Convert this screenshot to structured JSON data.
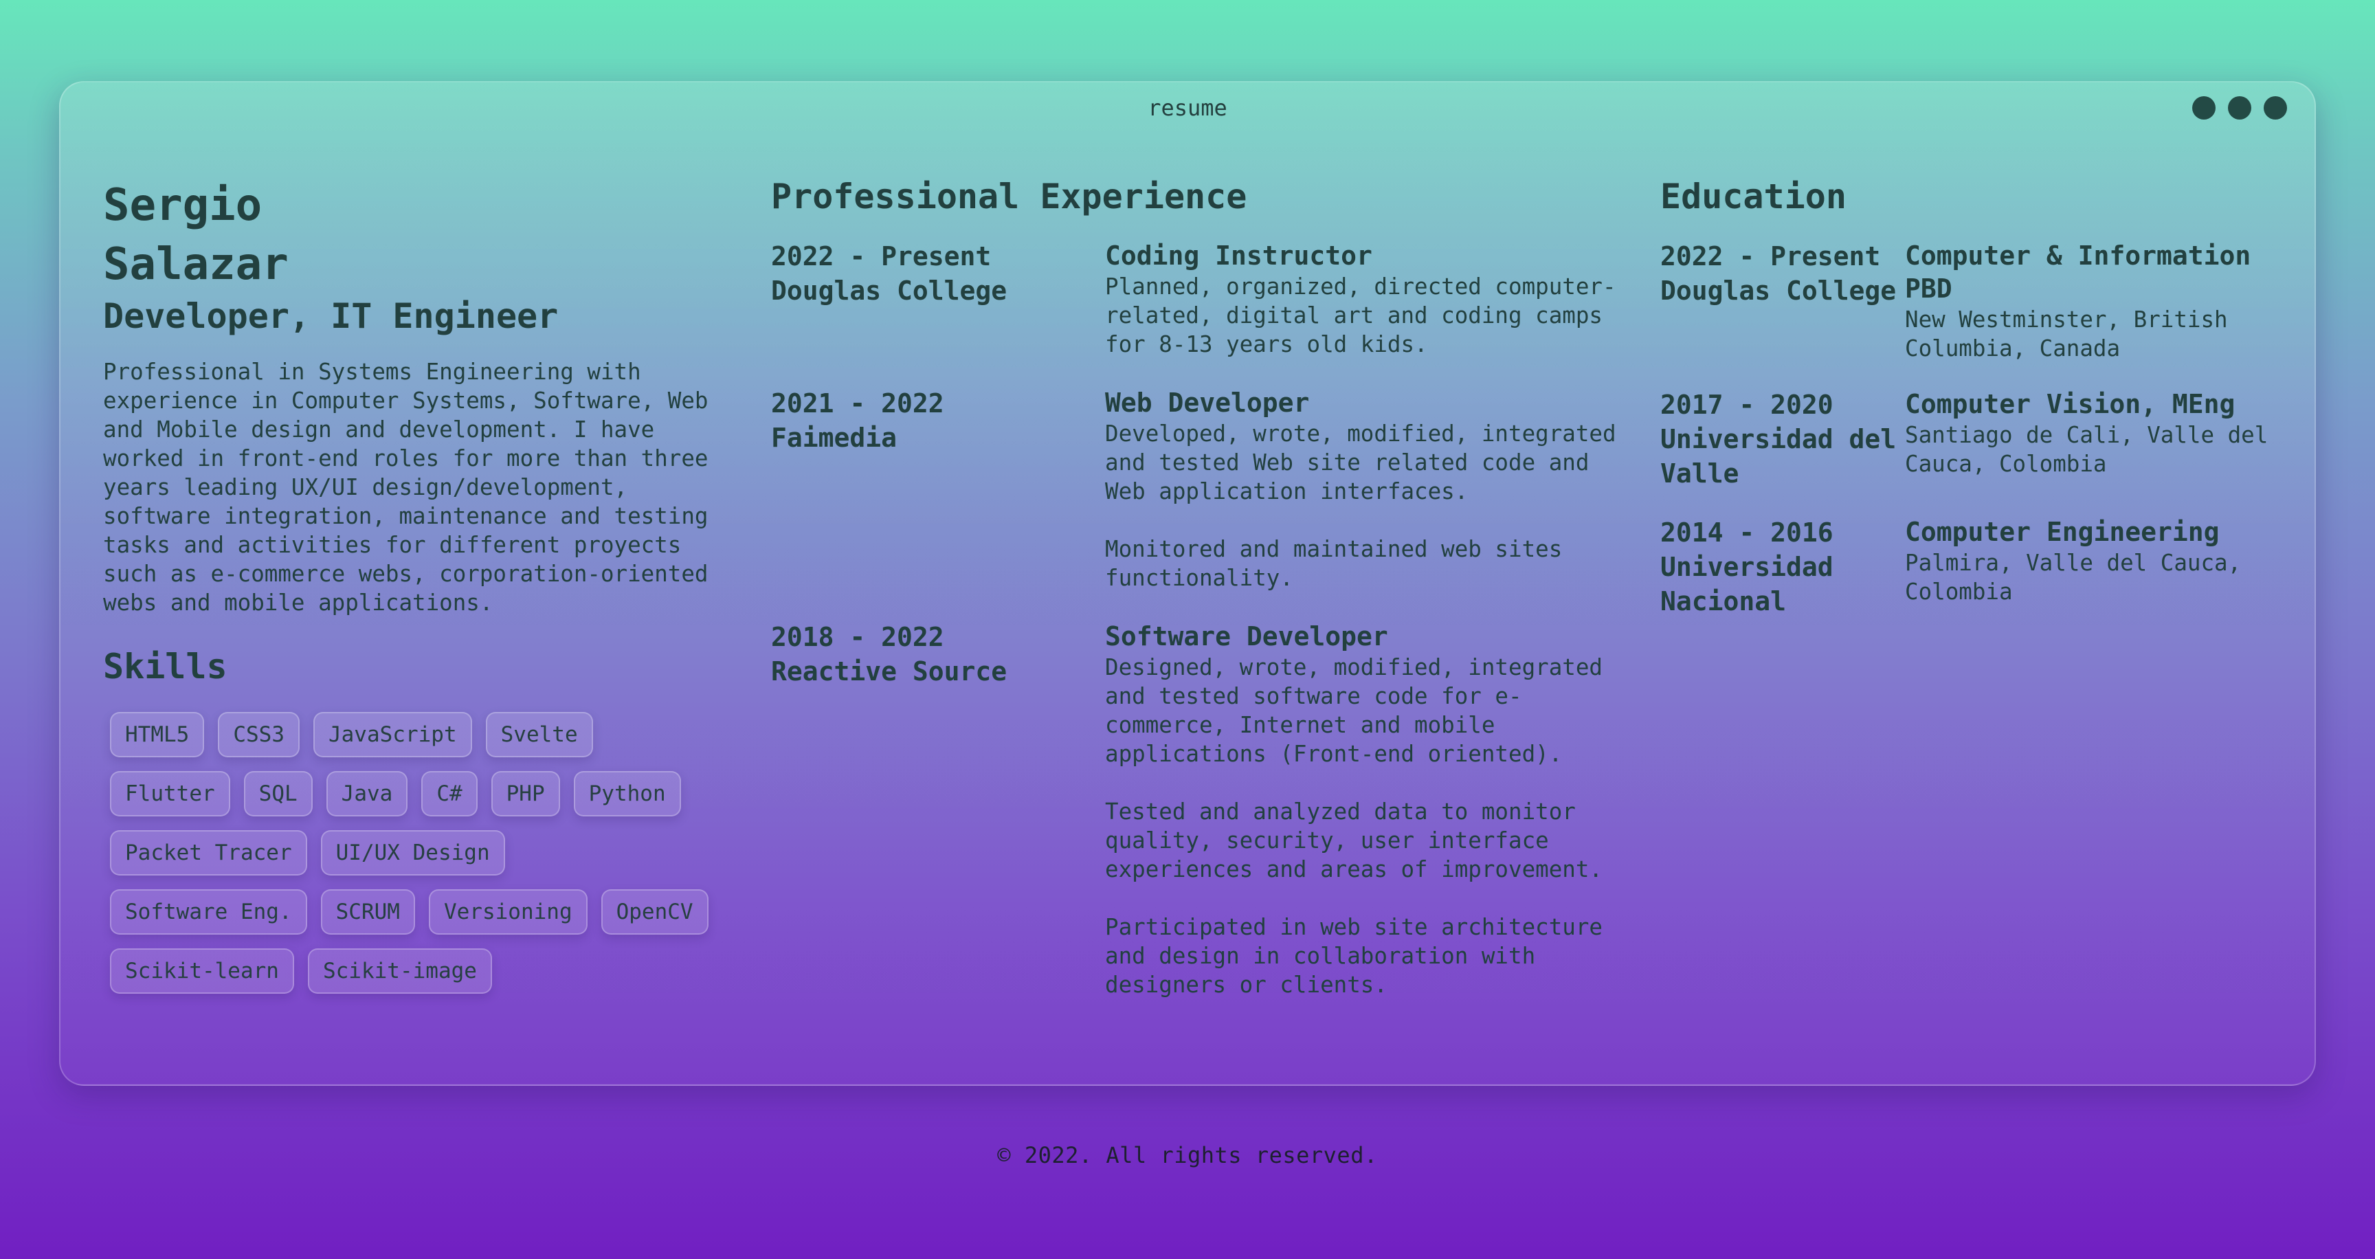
{
  "window": {
    "title": "resume"
  },
  "profile": {
    "first_name": "Sergio",
    "last_name": "Salazar",
    "role": "Developer, IT Engineer",
    "summary": "Professional in Systems Engineering with experience in Computer Systems, Software, Web and Mobile design and development. I have worked in front-end roles for more than three years leading UX/UI design/development, software integration, maintenance and testing tasks and activities for different proyects such as e-commerce webs, corporation-oriented webs and mobile applications."
  },
  "skills": {
    "title": "Skills",
    "items": [
      "HTML5",
      "CSS3",
      "JavaScript",
      "Svelte",
      "Flutter",
      "SQL",
      "Java",
      "C#",
      "PHP",
      "Python",
      "Packet Tracer",
      "UI/UX Design",
      "Software Eng.",
      "SCRUM",
      "Versioning",
      "OpenCV",
      "Scikit-learn",
      "Scikit-image"
    ]
  },
  "experience": {
    "title": "Professional Experience",
    "items": [
      {
        "period": "2022 - Present",
        "company": "Douglas College",
        "position": "Coding Instructor",
        "paragraphs": [
          "Planned, organized, directed computer-related, digital art and coding camps for 8-13 years old kids."
        ]
      },
      {
        "period": "2021 - 2022",
        "company": "Faimedia",
        "position": "Web Developer",
        "paragraphs": [
          "Developed, wrote, modified, integrated and tested Web site related code and Web application interfaces.",
          "Monitored and maintained web sites functionality."
        ]
      },
      {
        "period": "2018 - 2022",
        "company": "Reactive Source",
        "position": "Software Developer",
        "paragraphs": [
          "Designed, wrote, modified, integrated and tested software code for e-commerce, Internet and mobile applications (Front-end oriented).",
          "Tested and analyzed data to monitor quality, security, user interface experiences and areas of improvement.",
          "Participated in web site architecture and design in collaboration with designers or clients."
        ]
      }
    ]
  },
  "education": {
    "title": "Education",
    "items": [
      {
        "period": "2022 - Present",
        "institution": "Douglas College",
        "degree": "Computer & Information PBD",
        "location": "New Westminster, British Columbia, Canada"
      },
      {
        "period": "2017 - 2020",
        "institution": "Universidad del Valle",
        "degree": "Computer Vision, MEng",
        "location": "Santiago de Cali, Valle del Cauca, Colombia"
      },
      {
        "period": "2014 - 2016",
        "institution": "Universidad Nacional",
        "degree": "Computer Engineering",
        "location": "Palmira, Valle del Cauca, Colombia"
      }
    ]
  },
  "footer": {
    "text": "© 2022. All rights reserved."
  }
}
